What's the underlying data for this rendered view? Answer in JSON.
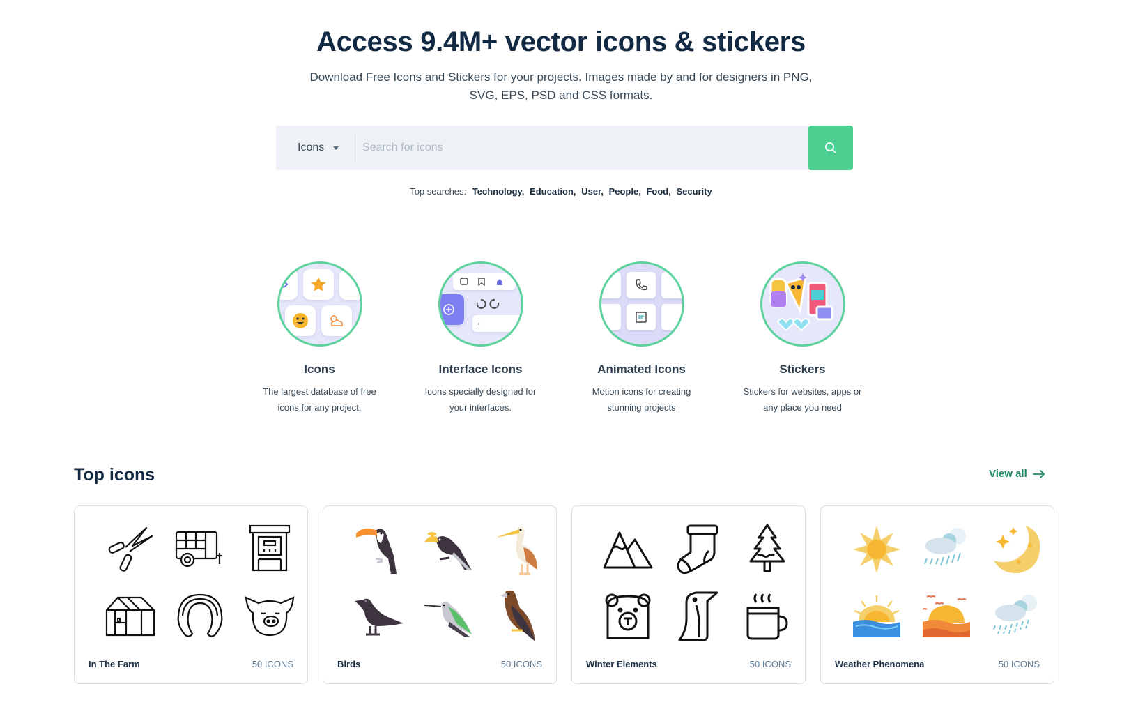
{
  "hero": {
    "title": "Access 9.4M+ vector icons & stickers",
    "subtitle": "Download Free Icons and Stickers for your projects. Images made by and for designers in PNG, SVG, EPS, PSD and CSS formats."
  },
  "search": {
    "type_selected": "Icons",
    "placeholder": "Search for icons",
    "value": "",
    "button_icon": "search-icon",
    "button_color": "#4fd093"
  },
  "top_searches": {
    "label": "Top searches:",
    "items": [
      "Technology",
      "Education",
      "User",
      "People",
      "Food",
      "Security"
    ]
  },
  "categories": [
    {
      "title": "Icons",
      "description": "The largest database of free icons for any project."
    },
    {
      "title": "Interface Icons",
      "description": "Icons specially designed for your interfaces."
    },
    {
      "title": "Animated Icons",
      "description": "Motion icons for creating stunning projects"
    },
    {
      "title": "Stickers",
      "description": "Stickers for websites, apps or any place you need"
    }
  ],
  "top_icons": {
    "title": "Top icons",
    "view_all_label": "View all",
    "packs": [
      {
        "name": "In The Farm",
        "count": "50 ICONS",
        "icons": [
          "pruning-shears-icon",
          "livestock-trailer-icon",
          "incubator-icon",
          "greenhouse-icon",
          "horseshoe-icon",
          "pig-icon"
        ]
      },
      {
        "name": "Birds",
        "count": "50 ICONS",
        "icons": [
          "toucan-icon",
          "hornbill-icon",
          "pelican-icon",
          "crow-icon",
          "hummingbird-icon",
          "eagle-icon"
        ]
      },
      {
        "name": "Winter Elements",
        "count": "50 ICONS",
        "icons": [
          "mountains-icon",
          "sock-icon",
          "pine-tree-icon",
          "bear-icon",
          "penguin-icon",
          "hot-drink-icon"
        ]
      },
      {
        "name": "Weather Phenomena",
        "count": "50 ICONS",
        "icons": [
          "sun-icon",
          "rain-cloud-icon",
          "moon-stars-icon",
          "sunrise-sea-icon",
          "sunset-icon",
          "heavy-rain-icon"
        ]
      }
    ]
  },
  "colors": {
    "accent_green": "#4fd093",
    "link_green": "#1d8b64",
    "heading": "#132a44"
  }
}
